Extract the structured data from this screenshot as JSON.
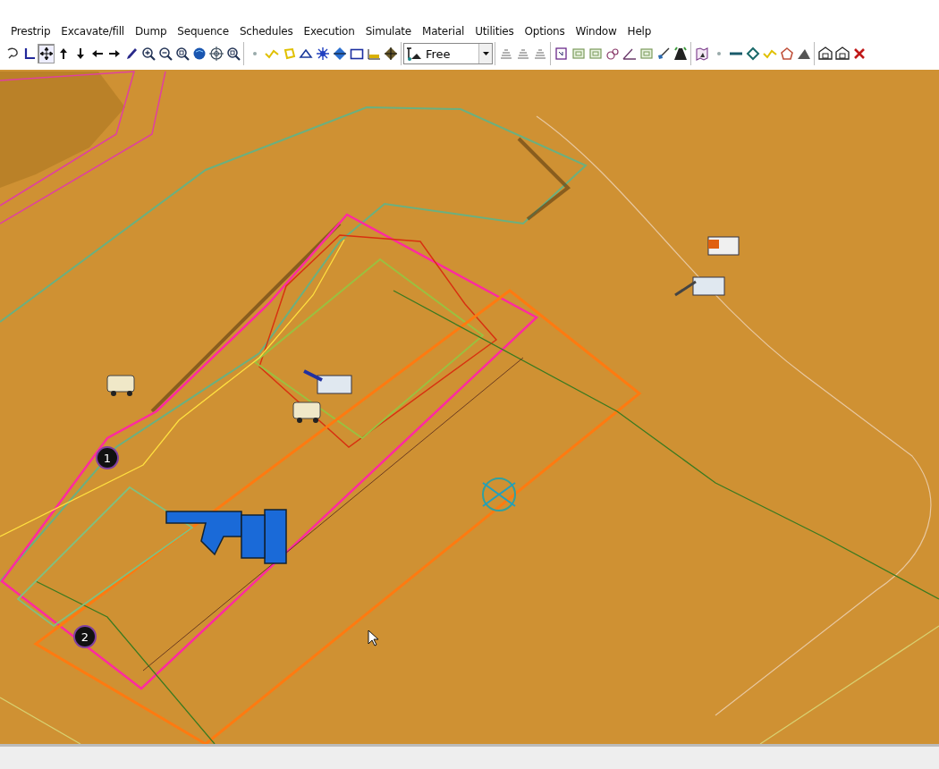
{
  "menu": [
    {
      "label": "Prestrip"
    },
    {
      "label": "Excavate/fill"
    },
    {
      "label": "Dump"
    },
    {
      "label": "Sequence"
    },
    {
      "label": "Schedules"
    },
    {
      "label": "Execution"
    },
    {
      "label": "Simulate"
    },
    {
      "label": "Material"
    },
    {
      "label": "Utilities"
    },
    {
      "label": "Options"
    },
    {
      "label": "Window"
    },
    {
      "label": "Help"
    }
  ],
  "toolbar": {
    "groups": [
      [
        {
          "kind": "lasso",
          "selected": false
        },
        {
          "kind": "axis",
          "selected": false
        },
        {
          "kind": "move",
          "selected": true
        },
        {
          "kind": "up",
          "selected": false
        },
        {
          "kind": "down",
          "selected": false
        },
        {
          "kind": "left",
          "selected": false
        },
        {
          "kind": "right",
          "selected": false
        },
        {
          "kind": "pencil",
          "selected": false
        },
        {
          "kind": "zoom-in",
          "selected": false
        },
        {
          "kind": "zoom-out",
          "selected": false
        },
        {
          "kind": "zoom-window",
          "selected": false
        },
        {
          "kind": "globe",
          "selected": false
        },
        {
          "kind": "target",
          "selected": false
        },
        {
          "kind": "zoom-previous",
          "selected": false
        }
      ],
      [
        {
          "kind": "dot",
          "selected": false
        },
        {
          "kind": "polyline",
          "selected": false
        },
        {
          "kind": "polygon",
          "selected": false
        },
        {
          "kind": "triangle",
          "selected": false
        },
        {
          "kind": "star",
          "selected": false
        },
        {
          "kind": "diamond",
          "selected": false
        },
        {
          "kind": "window",
          "selected": false
        },
        {
          "kind": "chart",
          "selected": false
        },
        {
          "kind": "diamond-dark",
          "selected": false
        }
      ],
      [
        {
          "kind": "combo"
        }
      ],
      [
        {
          "kind": "stack",
          "selected": false
        },
        {
          "kind": "stack",
          "selected": false
        },
        {
          "kind": "stack",
          "selected": false
        }
      ],
      [
        {
          "kind": "report",
          "selected": false
        },
        {
          "kind": "square",
          "selected": false
        },
        {
          "kind": "square",
          "selected": false
        },
        {
          "kind": "circles",
          "selected": false
        },
        {
          "kind": "angle",
          "selected": false
        },
        {
          "kind": "square",
          "selected": false
        },
        {
          "kind": "shovel",
          "selected": false
        },
        {
          "kind": "road",
          "selected": false
        }
      ],
      [
        {
          "kind": "map",
          "selected": false
        },
        {
          "kind": "dot",
          "selected": false
        },
        {
          "kind": "line",
          "selected": false
        },
        {
          "kind": "diamond-outline",
          "selected": false
        },
        {
          "kind": "polyline",
          "selected": false
        },
        {
          "kind": "pentagon",
          "selected": false
        },
        {
          "kind": "mountain",
          "selected": false
        }
      ],
      [
        {
          "kind": "house",
          "selected": false
        },
        {
          "kind": "house",
          "selected": false
        },
        {
          "kind": "close",
          "selected": false
        }
      ]
    ],
    "view_combo": {
      "value": "Free"
    }
  },
  "viewport": {
    "markers": [
      {
        "label": "1"
      },
      {
        "label": "2"
      }
    ]
  }
}
